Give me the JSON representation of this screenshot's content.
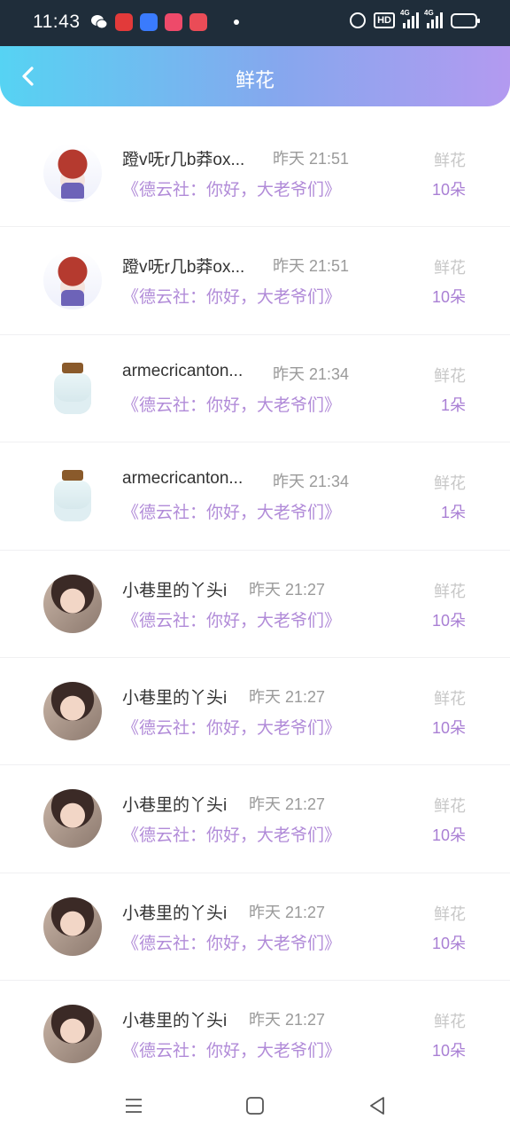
{
  "status_bar": {
    "time": "11:43",
    "network_label_1": "4G",
    "network_label_2": "4G",
    "hd_label": "HD",
    "battery_level": 0.5
  },
  "header": {
    "title": "鲜花"
  },
  "rows": [
    {
      "avatar": "anime-avatar",
      "name": "蹬v呒r几b莽ox...",
      "time": "昨天 21:51",
      "work": "《德云社：你好，大老爷们》",
      "gift": "鲜花",
      "count": "10朵"
    },
    {
      "avatar": "anime-avatar",
      "name": "蹬v呒r几b莽ox...",
      "time": "昨天 21:51",
      "work": "《德云社：你好，大老爷们》",
      "gift": "鲜花",
      "count": "10朵"
    },
    {
      "avatar": "jar-avatar",
      "name": "armecricanton...",
      "time": "昨天 21:34",
      "work": "《德云社：你好，大老爷们》",
      "gift": "鲜花",
      "count": "1朵"
    },
    {
      "avatar": "jar-avatar",
      "name": "armecricanton...",
      "time": "昨天 21:34",
      "work": "《德云社：你好，大老爷们》",
      "gift": "鲜花",
      "count": "1朵"
    },
    {
      "avatar": "photo-avatar",
      "name": "小巷里的丫头i",
      "time": "昨天 21:27",
      "work": "《德云社：你好，大老爷们》",
      "gift": "鲜花",
      "count": "10朵"
    },
    {
      "avatar": "photo-avatar",
      "name": "小巷里的丫头i",
      "time": "昨天 21:27",
      "work": "《德云社：你好，大老爷们》",
      "gift": "鲜花",
      "count": "10朵"
    },
    {
      "avatar": "photo-avatar",
      "name": "小巷里的丫头i",
      "time": "昨天 21:27",
      "work": "《德云社：你好，大老爷们》",
      "gift": "鲜花",
      "count": "10朵"
    },
    {
      "avatar": "photo-avatar",
      "name": "小巷里的丫头i",
      "time": "昨天 21:27",
      "work": "《德云社：你好，大老爷们》",
      "gift": "鲜花",
      "count": "10朵"
    },
    {
      "avatar": "photo-avatar",
      "name": "小巷里的丫头i",
      "time": "昨天 21:27",
      "work": "《德云社：你好，大老爷们》",
      "gift": "鲜花",
      "count": "10朵"
    }
  ],
  "nav_bar": {
    "icons": [
      "menu-icon",
      "home-square-icon",
      "back-triangle-icon"
    ]
  },
  "colors": {
    "header_start": "#56d3f3",
    "header_end": "#b39af0",
    "accent_purple": "#b18bd8",
    "muted_gray": "#9a9a9a"
  }
}
